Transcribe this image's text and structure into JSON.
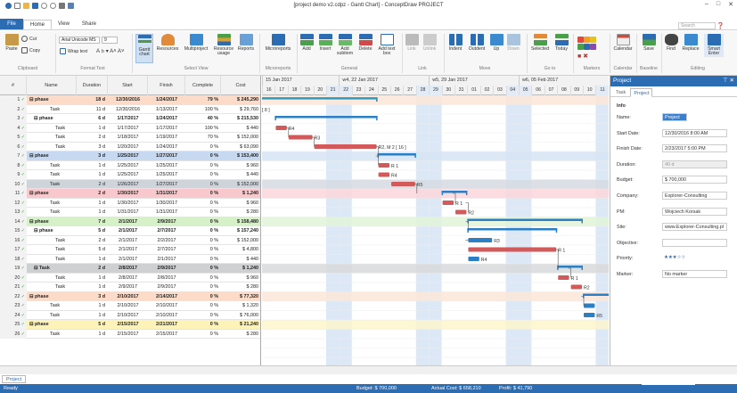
{
  "window": {
    "title": "[project demo v2.cdpz - Gantt Chart] - ConceptDraw PROJECT",
    "minimize": "–",
    "maximize": "□",
    "close": "✕"
  },
  "tabs": [
    "File",
    "Home",
    "View",
    "Share"
  ],
  "active_tab": "Home",
  "search": {
    "placeholder": "Search"
  },
  "ribbon": {
    "clipboard": {
      "paste": "Paste",
      "cut": "Cut",
      "copy": "Copy",
      "label": "Clipboard"
    },
    "format_text": {
      "font": "Arial Unicode MS",
      "size": "9",
      "wrap": "Wrap text",
      "label": "Format Text"
    },
    "view": {
      "gantt": "Gantt chart",
      "resources": "Resources",
      "multiproject": "Multiproject",
      "resource_usage": "Resource usage",
      "reports": "Reports",
      "label": "Select View"
    },
    "microreports": {
      "button": "Microreports",
      "label": "Microreports"
    },
    "general": {
      "add": "Add",
      "insert": "Insert",
      "add_subitem": "Add subitem",
      "delete": "Delete",
      "add_text_box": "Add text box",
      "label": "General"
    },
    "link": {
      "link": "Link",
      "unlink": "Unlink",
      "label": "Link"
    },
    "move": {
      "indent": "Indent",
      "outdent": "Outdent",
      "up": "Up",
      "down": "Down",
      "label": "Move"
    },
    "goto": {
      "selected": "Selected",
      "today": "Today",
      "label": "Go to"
    },
    "markers": {
      "label": "Markers"
    },
    "calendar": {
      "button": "Calendar",
      "label": "Calendar"
    },
    "baseline": {
      "save": "Save",
      "label": "Baseline"
    },
    "editing": {
      "find": "Find",
      "replace": "Replace",
      "smart_enter": "Smart Enter",
      "label": "Editing"
    }
  },
  "grid": {
    "columns": [
      "#",
      "Name",
      "Duration",
      "Start",
      "Finish",
      "Complete",
      "Cost"
    ],
    "rows": [
      {
        "n": "1",
        "name": "phase",
        "dur": "18 d",
        "start": "12/30/2016",
        "finish": "1/24/2017",
        "complete": "79 %",
        "cost": "$ 245,290",
        "type": "phase",
        "color": "#fcdcc8"
      },
      {
        "n": "2",
        "name": "Task",
        "dur": "11 d",
        "start": "12/30/2016",
        "finish": "1/13/2017",
        "complete": "100 %",
        "cost": "$ 29,760",
        "type": "task",
        "color": "#ffffff"
      },
      {
        "n": "3",
        "name": "phase",
        "dur": "6 d",
        "start": "1/17/2017",
        "finish": "1/24/2017",
        "complete": "40 %",
        "cost": "$ 215,530",
        "type": "subphase",
        "color": "#ffffff"
      },
      {
        "n": "4",
        "name": "Task",
        "dur": "1 d",
        "start": "1/17/2017",
        "finish": "1/17/2017",
        "complete": "100 %",
        "cost": "$ 440",
        "type": "task2",
        "color": "#ffffff"
      },
      {
        "n": "5",
        "name": "Task",
        "dur": "2 d",
        "start": "1/18/2017",
        "finish": "1/19/2017",
        "complete": "70 %",
        "cost": "$ 152,000",
        "type": "task2",
        "color": "#ffffff"
      },
      {
        "n": "6",
        "name": "Task",
        "dur": "3 d",
        "start": "1/20/2017",
        "finish": "1/24/2017",
        "complete": "0 %",
        "cost": "$ 63,090",
        "type": "task2",
        "color": "#ffffff"
      },
      {
        "n": "7",
        "name": "phase",
        "dur": "3 d",
        "start": "1/25/2017",
        "finish": "1/27/2017",
        "complete": "0 %",
        "cost": "$ 153,400",
        "type": "phase",
        "color": "#c7d9f1"
      },
      {
        "n": "8",
        "name": "Task",
        "dur": "1 d",
        "start": "1/25/2017",
        "finish": "1/25/2017",
        "complete": "0 %",
        "cost": "$ 960",
        "type": "task",
        "color": "#ffffff"
      },
      {
        "n": "9",
        "name": "Task",
        "dur": "1 d",
        "start": "1/25/2017",
        "finish": "1/25/2017",
        "complete": "0 %",
        "cost": "$ 440",
        "type": "task",
        "color": "#ffffff"
      },
      {
        "n": "10",
        "name": "Task",
        "dur": "2 d",
        "start": "1/26/2017",
        "finish": "1/27/2017",
        "complete": "0 %",
        "cost": "$ 152,000",
        "type": "task",
        "color": "#cfd4db"
      },
      {
        "n": "11",
        "name": "phase",
        "dur": "2 d",
        "start": "1/30/2017",
        "finish": "1/31/2017",
        "complete": "0 %",
        "cost": "$ 1,240",
        "type": "phase",
        "color": "#f8c8cc"
      },
      {
        "n": "12",
        "name": "Task",
        "dur": "1 d",
        "start": "1/30/2017",
        "finish": "1/30/2017",
        "complete": "0 %",
        "cost": "$ 960",
        "type": "task",
        "color": "#ffffff"
      },
      {
        "n": "13",
        "name": "Task",
        "dur": "1 d",
        "start": "1/31/2017",
        "finish": "1/31/2017",
        "complete": "0 %",
        "cost": "$ 280",
        "type": "task",
        "color": "#ffffff"
      },
      {
        "n": "14",
        "name": "phase",
        "dur": "7 d",
        "start": "2/1/2017",
        "finish": "2/9/2017",
        "complete": "0 %",
        "cost": "$ 158,480",
        "type": "phase",
        "color": "#d6f0c8"
      },
      {
        "n": "15",
        "name": "phase",
        "dur": "5 d",
        "start": "2/1/2017",
        "finish": "2/7/2017",
        "complete": "0 %",
        "cost": "$ 157,240",
        "type": "subphase",
        "color": "#ffffff"
      },
      {
        "n": "16",
        "name": "Task",
        "dur": "2 d",
        "start": "2/1/2017",
        "finish": "2/2/2017",
        "complete": "0 %",
        "cost": "$ 152,000",
        "type": "task2",
        "color": "#ffffff"
      },
      {
        "n": "17",
        "name": "Task",
        "dur": "5 d",
        "start": "2/1/2017",
        "finish": "2/7/2017",
        "complete": "0 %",
        "cost": "$ 4,800",
        "type": "task2",
        "color": "#ffffff"
      },
      {
        "n": "18",
        "name": "Task",
        "dur": "1 d",
        "start": "2/1/2017",
        "finish": "2/1/2017",
        "complete": "0 %",
        "cost": "$ 440",
        "type": "task2",
        "color": "#ffffff"
      },
      {
        "n": "19",
        "name": "Task",
        "dur": "2 d",
        "start": "2/8/2017",
        "finish": "2/9/2017",
        "complete": "0 %",
        "cost": "$ 1,240",
        "type": "subphase",
        "color": "#cfd0d2"
      },
      {
        "n": "20",
        "name": "Task",
        "dur": "1 d",
        "start": "2/8/2017",
        "finish": "2/8/2017",
        "complete": "0 %",
        "cost": "$ 960",
        "type": "task2",
        "color": "#ffffff"
      },
      {
        "n": "21",
        "name": "Task",
        "dur": "1 d",
        "start": "2/9/2017",
        "finish": "2/9/2017",
        "complete": "0 %",
        "cost": "$ 280",
        "type": "task2",
        "color": "#ffffff"
      },
      {
        "n": "22",
        "name": "phase",
        "dur": "3 d",
        "start": "2/10/2017",
        "finish": "2/14/2017",
        "complete": "0 %",
        "cost": "$ 77,320",
        "type": "phase",
        "color": "#fcdcc8"
      },
      {
        "n": "23",
        "name": "Task",
        "dur": "1 d",
        "start": "2/10/2017",
        "finish": "2/10/2017",
        "complete": "0 %",
        "cost": "$ 1,320",
        "type": "task",
        "color": "#ffffff"
      },
      {
        "n": "24",
        "name": "Task",
        "dur": "1 d",
        "start": "2/10/2017",
        "finish": "2/10/2017",
        "complete": "0 %",
        "cost": "$ 76,000",
        "type": "task",
        "color": "#ffffff"
      },
      {
        "n": "25",
        "name": "phase",
        "dur": "5 d",
        "start": "2/15/2017",
        "finish": "2/21/2017",
        "complete": "0 %",
        "cost": "$ 21,240",
        "type": "phase",
        "color": "#fdf3b8"
      },
      {
        "n": "26",
        "name": "Task",
        "dur": "1 d",
        "start": "2/15/2017",
        "finish": "2/15/2017",
        "complete": "0 %",
        "cost": "$ 280",
        "type": "task",
        "color": "#ffffff"
      }
    ]
  },
  "timeline": {
    "weeks": [
      "15 Jan 2017",
      "w4, 22 Jan 2017",
      "w5, 29 Jan 2017",
      "w6, 05 Feb 2017"
    ],
    "days": [
      "16",
      "17",
      "18",
      "19",
      "20",
      "21",
      "22",
      "23",
      "24",
      "25",
      "26",
      "27",
      "28",
      "29",
      "30",
      "31",
      "01",
      "02",
      "03",
      "04",
      "05",
      "06",
      "07",
      "08",
      "09",
      "10",
      "11"
    ],
    "bar_labels": [
      "[ 8 ]",
      "R4",
      "R3",
      "R2, M 2 [ 16 ]",
      "R 1",
      "R4",
      "R5",
      "R 1",
      "R2",
      "R3",
      "R 1",
      "R4",
      "R 1",
      "R2",
      "R5"
    ]
  },
  "panel": {
    "title": "Project",
    "pin": "⊤ ✕",
    "tabs": [
      "Task",
      "Project"
    ],
    "section": "Info",
    "fields": [
      {
        "label": "Name:",
        "value": "Project"
      },
      {
        "label": "Start Date:",
        "value": "12/30/2016   8:00 AM"
      },
      {
        "label": "Finish Date:",
        "value": "2/23/2017   5:00 PM"
      },
      {
        "label": "Duration:",
        "value": "40 d"
      },
      {
        "label": "Budget:",
        "value": "$ 700,000"
      },
      {
        "label": "Company:",
        "value": "Explorer-Consulting"
      },
      {
        "label": "PM:",
        "value": "Wojciech Korsak"
      },
      {
        "label": "Site:",
        "value": "www.Explorer-Consulting.pl"
      },
      {
        "label": "Objective:",
        "value": ""
      },
      {
        "label": "Priority:",
        "value": "★★★☆☆"
      },
      {
        "label": "Marker:",
        "value": "No marker"
      }
    ]
  },
  "sheet_tab": "Project",
  "status": {
    "ready": "Ready",
    "budget": "Budget: $ 700,000",
    "actual_cost": "Actual Cost: $ 658,210",
    "profit": "Profit: $ 41,790"
  },
  "colors": {
    "accent": "#2b6cb3",
    "bar_red": "#d35a5a",
    "bar_blue": "#2b7fc4",
    "weekend": "#dde8f6"
  }
}
